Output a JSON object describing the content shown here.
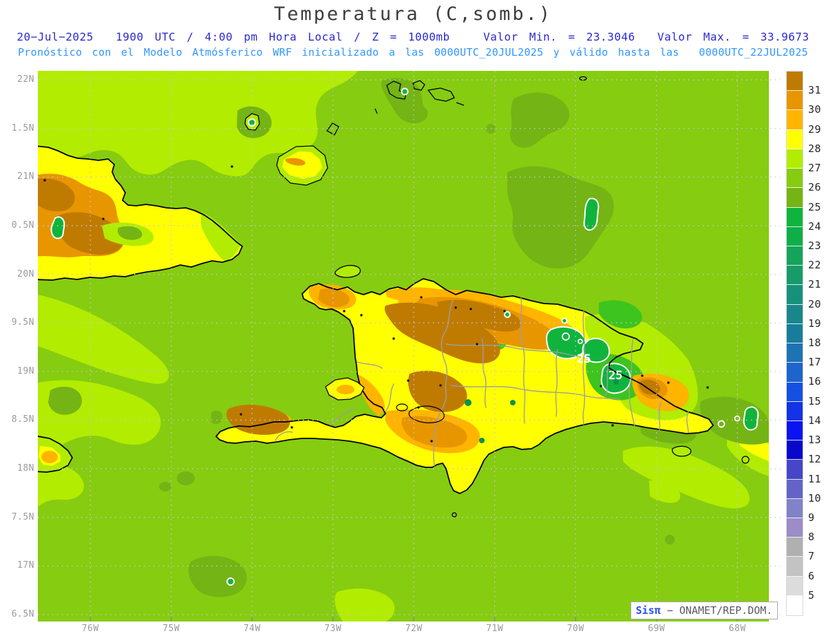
{
  "header": {
    "title": "Temperatura (C,somb.)",
    "line2": "20−Jul−2025  1900 UTC / 4:00 pm Hora Local / Z = 1000mb   Valor Min. = 23.3046  Valor Max. = 33.9673",
    "line3": "Pronóstico con el Modelo Atmósferico WRF inicializado a las 0000UTC_20JUL2025 y válido hasta las  0000UTC_22JUL2025"
  },
  "map": {
    "lat_labels": [
      "22N",
      "1.5N",
      "21N",
      "0.5N",
      "20N",
      "9.5N",
      "19N",
      "8.5N",
      "18N",
      "7.5N",
      "17N",
      "6.5N"
    ],
    "lon_labels": [
      "76W",
      "75W",
      "74W",
      "73W",
      "72W",
      "71W",
      "70W",
      "69W",
      "68W"
    ],
    "contour_labels": [
      "25",
      "25"
    ],
    "colors": {
      "brown": "#bf7b00",
      "orange": "#e89600",
      "amber": "#ffb400",
      "yellow": "#ffff00",
      "chartreuse": "#b2ec00",
      "sea_green": "#86cc10",
      "olive": "#74b414",
      "mid_green": "#3ec41e",
      "kelly": "#10b43c",
      "dark_green": "#0c9150"
    }
  },
  "colorbar": {
    "labels": [
      "31",
      "30",
      "29",
      "28",
      "27",
      "26",
      "25",
      "24",
      "23",
      "22",
      "21",
      "20",
      "19",
      "18",
      "17",
      "16",
      "15",
      "14",
      "13",
      "12",
      "11",
      "10",
      "9",
      "8",
      "7",
      "6",
      "5"
    ],
    "colors": [
      "#bf7b00",
      "#e89600",
      "#ffb400",
      "#ffff00",
      "#b2ec00",
      "#86cc10",
      "#74b414",
      "#10b43c",
      "#0fae4b",
      "#14a55a",
      "#169b69",
      "#18917b",
      "#18878c",
      "#187d9b",
      "#1e73b4",
      "#1e64cd",
      "#1450e1",
      "#1432e6",
      "#0a14f0",
      "#0808cd",
      "#4646c8",
      "#6464c8",
      "#8282c8",
      "#9c8cc8",
      "#b0b0b0",
      "#c3c3c3",
      "#dcdcdc",
      "#ffffff"
    ]
  },
  "watermark": {
    "brand": "Sisπ",
    "org": "− ONAMET/REP.DOM."
  }
}
